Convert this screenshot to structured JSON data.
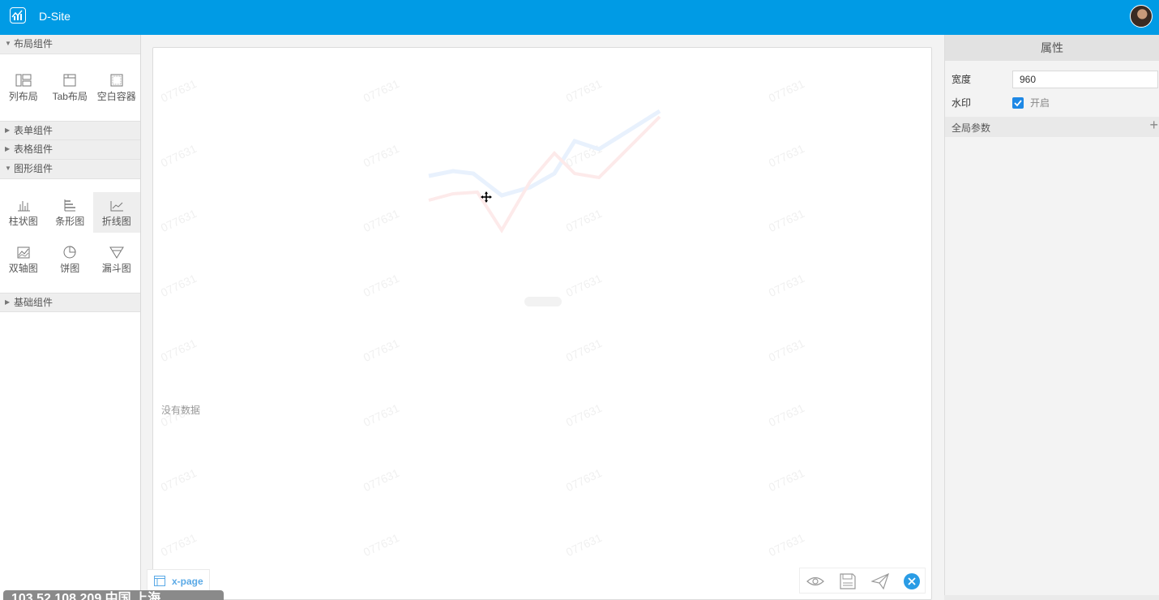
{
  "header": {
    "app_title": "D-Site",
    "logo_icon": "chart-logo-icon",
    "avatar_icon": "user-avatar"
  },
  "left_panel": {
    "sections": [
      {
        "title": "布局组件",
        "expanded": true,
        "items": [
          {
            "label": "列布局",
            "icon": "column-layout-icon"
          },
          {
            "label": "Tab布局",
            "icon": "tab-layout-icon"
          },
          {
            "label": "空白容器",
            "icon": "blank-container-icon"
          }
        ]
      },
      {
        "title": "表单组件",
        "expanded": false
      },
      {
        "title": "表格组件",
        "expanded": false
      },
      {
        "title": "图形组件",
        "expanded": true,
        "items": [
          {
            "label": "柱状图",
            "icon": "bar-chart-icon"
          },
          {
            "label": "条形图",
            "icon": "horizontal-bar-chart-icon"
          },
          {
            "label": "折线图",
            "icon": "line-chart-icon",
            "active": true
          },
          {
            "label": "双轴图",
            "icon": "dual-axis-chart-icon"
          },
          {
            "label": "饼图",
            "icon": "pie-chart-icon"
          },
          {
            "label": "漏斗图",
            "icon": "funnel-chart-icon"
          }
        ]
      },
      {
        "title": "基础组件",
        "expanded": false
      }
    ]
  },
  "canvas": {
    "watermark_text": "077631",
    "no_data_text": "没有数据",
    "page_tab_label": "x-page"
  },
  "toolbar": {
    "preview_icon": "eye-icon",
    "save_icon": "save-icon",
    "publish_icon": "send-icon",
    "close_icon": "close-icon"
  },
  "right_panel": {
    "title": "属性",
    "width_label": "宽度",
    "width_value": "960",
    "watermark_label": "水印",
    "watermark_checked": true,
    "watermark_option": "开启",
    "global_params_label": "全局参数",
    "add_symbol": "+"
  },
  "overlay": {
    "ip_text": "103.52.108.209 中国 上海"
  },
  "colors": {
    "header_bg": "#009be5",
    "accent": "#1e88e5",
    "page_tab_text": "#5aa9e6"
  }
}
